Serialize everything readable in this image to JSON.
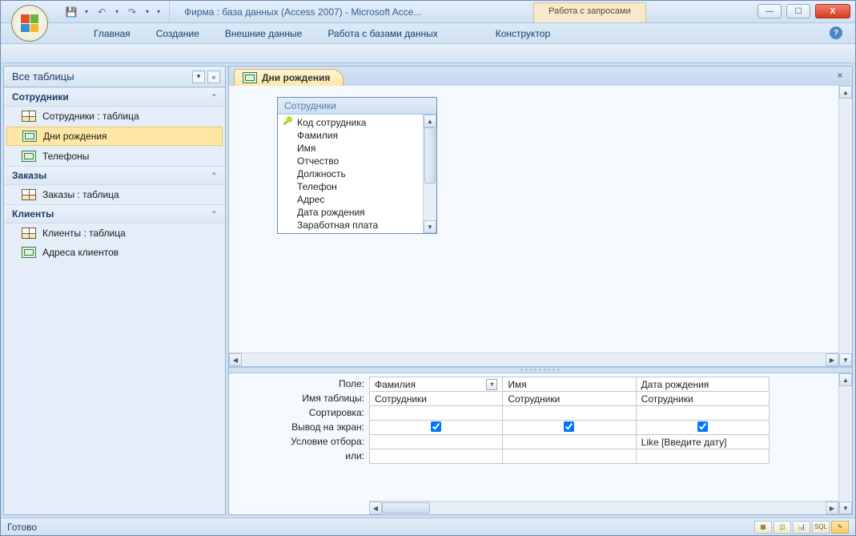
{
  "window": {
    "title": "Фирма : база данных (Access 2007)  -  Microsoft Acce...",
    "context_tab": "Работа с запросами"
  },
  "ribbon": {
    "tabs": [
      "Главная",
      "Создание",
      "Внешние данные",
      "Работа с базами данных",
      "Конструктор"
    ],
    "active_index": 4
  },
  "nav": {
    "header": "Все таблицы",
    "groups": [
      {
        "title": "Сотрудники",
        "items": [
          {
            "label": "Сотрудники : таблица",
            "icon": "table",
            "selected": false
          },
          {
            "label": "Дни рождения",
            "icon": "query",
            "selected": true
          },
          {
            "label": "Телефоны",
            "icon": "query",
            "selected": false
          }
        ]
      },
      {
        "title": "Заказы",
        "items": [
          {
            "label": "Заказы : таблица",
            "icon": "table",
            "selected": false
          }
        ]
      },
      {
        "title": "Клиенты",
        "items": [
          {
            "label": "Клиенты : таблица",
            "icon": "table",
            "selected": false
          },
          {
            "label": "Адреса клиентов",
            "icon": "query",
            "selected": false
          }
        ]
      }
    ]
  },
  "document": {
    "tab_label": "Дни рождения"
  },
  "field_list": {
    "title": "Сотрудники",
    "fields": [
      "Код сотрудника",
      "Фамилия",
      "Имя",
      "Отчество",
      "Должность",
      "Телефон",
      "Адрес",
      "Дата рождения",
      "Заработная плата"
    ],
    "key_index": 0
  },
  "grid": {
    "rows": [
      "Поле:",
      "Имя таблицы:",
      "Сортировка:",
      "Вывод на экран:",
      "Условие отбора:",
      "или:"
    ],
    "columns": [
      {
        "field": "Фамилия",
        "table": "Сотрудники",
        "sort": "",
        "show": true,
        "criteria": "",
        "or": "",
        "dropdown": true
      },
      {
        "field": "Имя",
        "table": "Сотрудники",
        "sort": "",
        "show": true,
        "criteria": "",
        "or": ""
      },
      {
        "field": "Дата рождения",
        "table": "Сотрудники",
        "sort": "",
        "show": true,
        "criteria": "Like [Введите дату]",
        "or": ""
      }
    ]
  },
  "status": {
    "text": "Готово",
    "sql_label": "SQL"
  }
}
